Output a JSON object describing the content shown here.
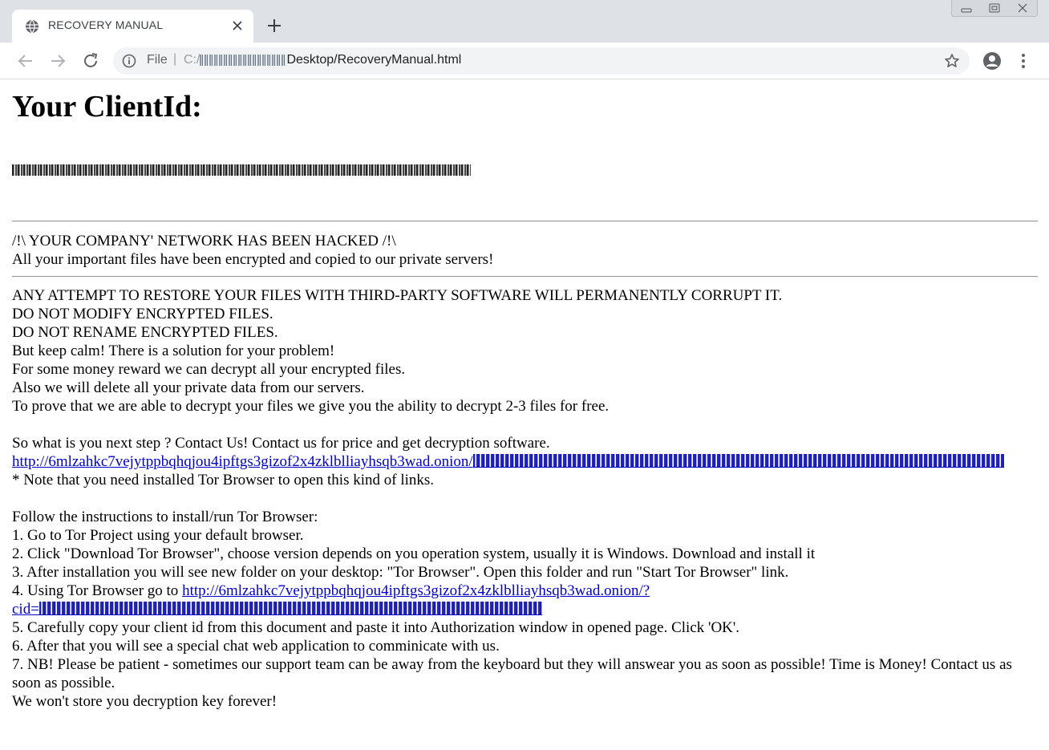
{
  "browser": {
    "tab_title": "RECOVERY MANUAL",
    "omnibox": {
      "scheme_label": "File",
      "separator": "|",
      "url_prefix": "C:/",
      "url_visible": "Desktop/RecoveryManual.html"
    }
  },
  "page": {
    "heading": "Your ClientId:",
    "section1": {
      "line1": "/!\\ YOUR COMPANY' NETWORK HAS BEEN HACKED /!\\",
      "line2": "All your important files have been encrypted and copied to our private servers!"
    },
    "section2": {
      "lines": [
        "ANY ATTEMPT TO RESTORE YOUR FILES WITH THIRD-PARTY SOFTWARE WILL PERMANENTLY CORRUPT IT.",
        "DO NOT MODIFY ENCRYPTED FILES.",
        "DO NOT RENAME ENCRYPTED FILES.",
        "But keep calm! There is a solution for your problem!",
        "For some money reward we can decrypt all your encrypted files.",
        "Also we will delete all your private data from our servers.",
        "To prove that we are able to decrypt your files we give you the ability to decrypt 2-3 files for free."
      ]
    },
    "contact": {
      "line1": "So what is you next step ? Contact Us! Contact us for price and get decryption software.",
      "link_visible": "http://6mlzahkc7vejytppbqhqjou4ipftgs3gizof2x4zklblliayhsqb3wad.onion/",
      "note": "* Note that you need installed Tor Browser to open this kind of links."
    },
    "instructions": {
      "header": "Follow the instructions to install/run Tor Browser:",
      "step1": "1. Go to Tor Project using your default browser.",
      "step2": "2. Click \"Download Tor Browser\", choose version depends on you operation system, usually it is Windows. Download and install it",
      "step3": "3. After installation you will see new folder on your desktop: \"Tor Browser\". Open this folder and run \"Start Tor Browser\" link.",
      "step4_text": "4. Using Tor Browser go to ",
      "step4_link": "http://6mlzahkc7vejytppbqhqjou4ipftgs3gizof2x4zklblliayhsqb3wad.onion/?",
      "step4_link_line2": "cid=",
      "step5": "5. Carefully copy your client id from this document and paste it into Authorization window in opened page. Click 'OK'.",
      "step6": "6. After that you will see a special chat web application to comminicate with us.",
      "step7": "7. NB! Please be patient - sometimes our support team can be away from the keyboard but they will answear you as soon as possible! Time is Money! Contact us as soon as possible.",
      "closing": "We won't store you decryption key forever!"
    }
  }
}
